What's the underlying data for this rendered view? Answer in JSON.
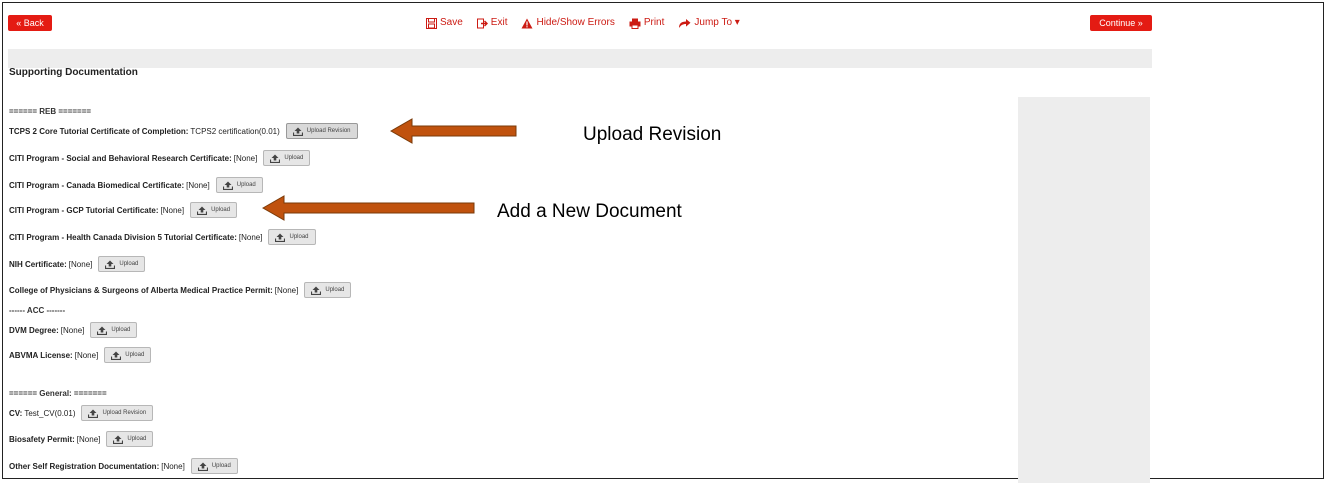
{
  "toolbar": {
    "back_label": "« Back",
    "save_label": "Save",
    "exit_label": "Exit",
    "errors_label": "Hide/Show Errors",
    "print_label": "Print",
    "jump_label": "Jump To ▾",
    "continue_label": "Continue »"
  },
  "section_title": "Supporting Documentation",
  "dividers": {
    "reb": "====== REB =======",
    "acc": "------ ACC -------",
    "general": "====== General: ======="
  },
  "docs": [
    {
      "label": "TCPS 2 Core Tutorial Certificate of Completion:",
      "value": "TCPS2 certification(0.01)",
      "button": "Upload Revision"
    },
    {
      "label": "CITI Program - Social and Behavioral Research Certificate:",
      "value": "[None]",
      "button": "Upload"
    },
    {
      "label": "CITI Program - Canada Biomedical Certificate:",
      "value": "[None]",
      "button": "Upload"
    },
    {
      "label": "CITI Program - GCP Tutorial Certificate:",
      "value": "[None]",
      "button": "Upload"
    },
    {
      "label": "CITI Program - Health Canada Division 5 Tutorial Certificate:",
      "value": "[None]",
      "button": "Upload"
    },
    {
      "label": "NIH Certificate:",
      "value": "[None]",
      "button": "Upload"
    },
    {
      "label": "College of Physicians & Surgeons of Alberta Medical Practice Permit:",
      "value": "[None]",
      "button": "Upload"
    },
    {
      "label": "DVM Degree:",
      "value": "[None]",
      "button": "Upload"
    },
    {
      "label": "ABVMA License:",
      "value": "[None]",
      "button": "Upload"
    },
    {
      "label": "CV:",
      "value": "Test_CV(0.01)",
      "button": "Upload Revision"
    },
    {
      "label": "Biosafety Permit:",
      "value": "[None]",
      "button": "Upload"
    },
    {
      "label": "Other Self Registration Documentation:",
      "value": "[None]",
      "button": "Upload"
    }
  ],
  "annotations": {
    "upload_revision": "Upload Revision",
    "add_new": "Add a New Document"
  },
  "colors": {
    "accent_red": "#e41b13",
    "arrow": "#c0520e"
  }
}
